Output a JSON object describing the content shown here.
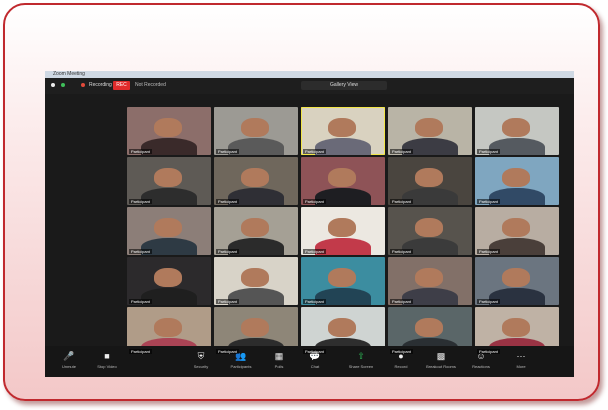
{
  "window": {
    "title": "Zoom Meeting"
  },
  "topbar": {
    "recording_label": "Recording",
    "rec_badge": "REC",
    "recording_status": "Not Recorded",
    "view_label": "Gallery View"
  },
  "participants": [
    {
      "name": "Participant",
      "bg": "#8c6e6a",
      "shirt": "#3a2a2a"
    },
    {
      "name": "Participant",
      "bg": "#9c9a94",
      "shirt": "#5a5a5a"
    },
    {
      "name": "Participant",
      "bg": "#d9d2c0",
      "shirt": "#6a6a78",
      "active": true
    },
    {
      "name": "Participant",
      "bg": "#b9b4a6",
      "shirt": "#3c3c44"
    },
    {
      "name": "Participant",
      "bg": "#c5c7c2",
      "shirt": "#555a60"
    },
    {
      "name": "Participant",
      "bg": "#5e5a55",
      "shirt": "#2d2d2d"
    },
    {
      "name": "Participant",
      "bg": "#6f675c",
      "shirt": "#2f2f35"
    },
    {
      "name": "Participant",
      "bg": "#8e5357",
      "shirt": "#1e1e22"
    },
    {
      "name": "Participant",
      "bg": "#4a453f",
      "shirt": "#3a3a3a"
    },
    {
      "name": "Participant",
      "bg": "#7fa6c0",
      "shirt": "#314a66"
    },
    {
      "name": "Participant",
      "bg": "#8c7e78",
      "shirt": "#2e3a44"
    },
    {
      "name": "Participant",
      "bg": "#a5a095",
      "shirt": "#2b2b2b"
    },
    {
      "name": "Participant",
      "bg": "#ece8e1",
      "shirt": "#c23a4a"
    },
    {
      "name": "Participant",
      "bg": "#57534d",
      "shirt": "#3b3b3b"
    },
    {
      "name": "Participant",
      "bg": "#b8ada2",
      "shirt": "#4a3f3a"
    },
    {
      "name": "Participant",
      "bg": "#2c2a2c",
      "shirt": "#1f1f1f"
    },
    {
      "name": "Participant",
      "bg": "#d8d3c8",
      "shirt": "#555555"
    },
    {
      "name": "Participant",
      "bg": "#3c8da0",
      "shirt": "#224455"
    },
    {
      "name": "Participant",
      "bg": "#827068",
      "shirt": "#3e3e48"
    },
    {
      "name": "Participant",
      "bg": "#6b7580",
      "shirt": "#2a3240"
    },
    {
      "name": "Participant",
      "bg": "#b09c88",
      "shirt": "#aa4455"
    },
    {
      "name": "Participant",
      "bg": "#8e8678",
      "shirt": "#2c2c2c"
    },
    {
      "name": "Participant",
      "bg": "#cfd4d2",
      "shirt": "#2e2e2e"
    },
    {
      "name": "Participant",
      "bg": "#5a6668",
      "shirt": "#2a2f33"
    },
    {
      "name": "Participant",
      "bg": "#bfb2a5",
      "shirt": "#9a3344"
    }
  ],
  "toolbar": {
    "items": [
      {
        "icon": "🎤",
        "label": "Unmute"
      },
      {
        "icon": "■",
        "label": "Stop Video"
      },
      {
        "icon": "⛨",
        "label": "Security"
      },
      {
        "icon": "👥",
        "label": "Participants"
      },
      {
        "icon": "▦",
        "label": "Polls"
      },
      {
        "icon": "💬",
        "label": "Chat"
      },
      {
        "icon": "⇧",
        "label": "Share Screen"
      },
      {
        "icon": "●",
        "label": "Record"
      },
      {
        "icon": "▩",
        "label": "Breakout Rooms"
      },
      {
        "icon": "☺",
        "label": "Reactions"
      },
      {
        "icon": "⋯",
        "label": "More"
      }
    ]
  }
}
